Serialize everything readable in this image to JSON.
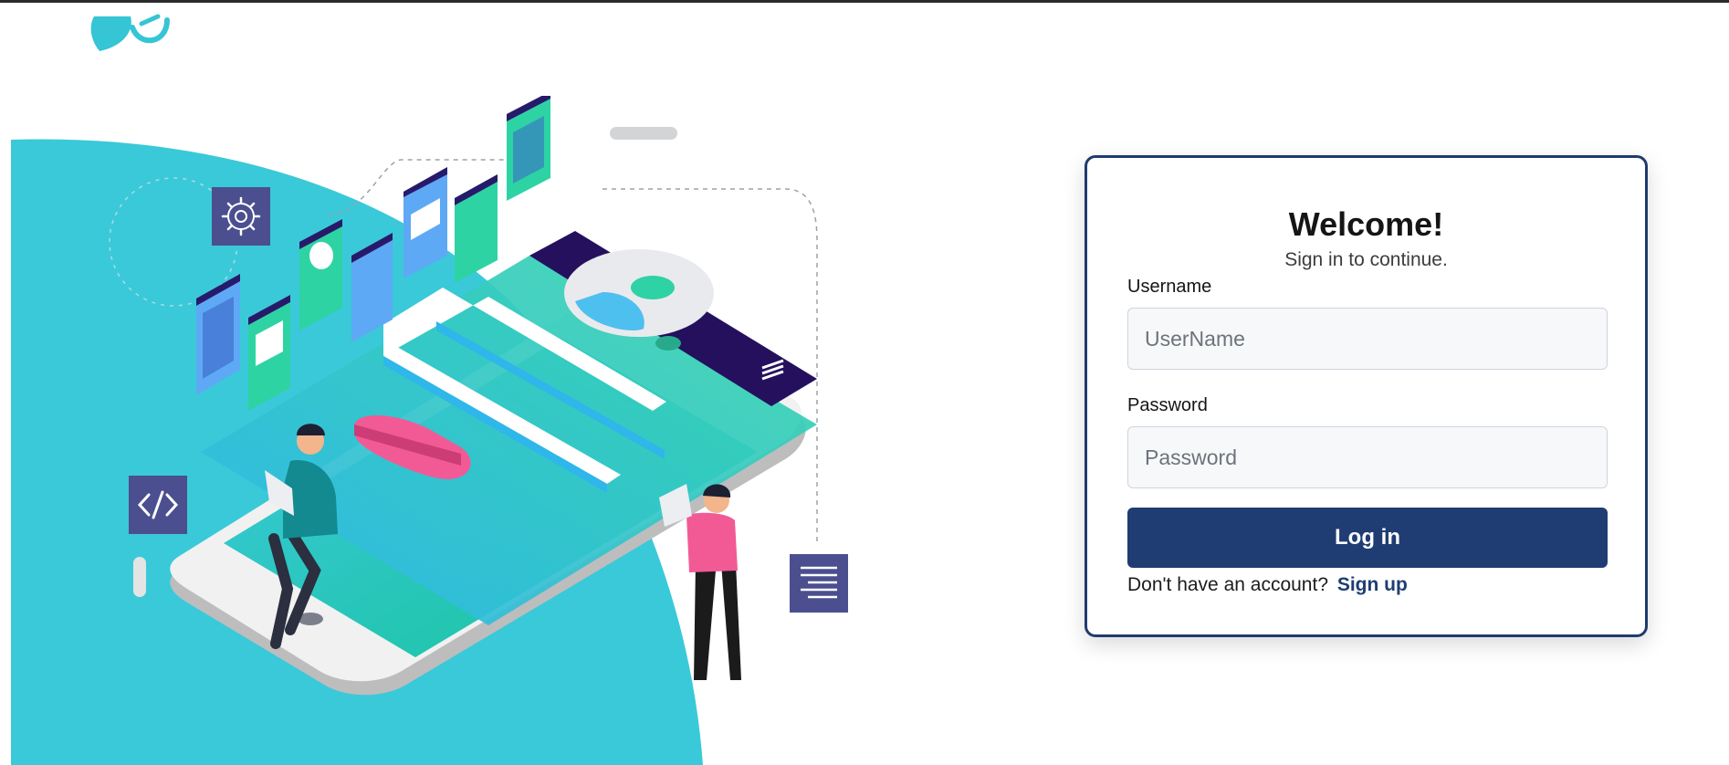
{
  "login": {
    "title": "Welcome!",
    "subtitle": "Sign in to continue.",
    "username_label": "Username",
    "username_placeholder": "UserName",
    "username_value": "",
    "password_label": "Password",
    "password_placeholder": "Password",
    "password_value": "",
    "submit_label": "Log in",
    "signup_prompt": "Don't have an account?",
    "signup_link": "Sign up"
  },
  "icons": {
    "logo": "brand-logo-icon",
    "settings": "gear-icon",
    "code": "code-icon",
    "document": "document-lines-icon"
  },
  "colors": {
    "primary": "#1f3d73",
    "card_border": "#1f3b70",
    "accent_teal": "#39c8d6",
    "accent_green": "#2ed3a4",
    "accent_pink": "#f25a96",
    "accent_purple": "#4b4f8f"
  }
}
